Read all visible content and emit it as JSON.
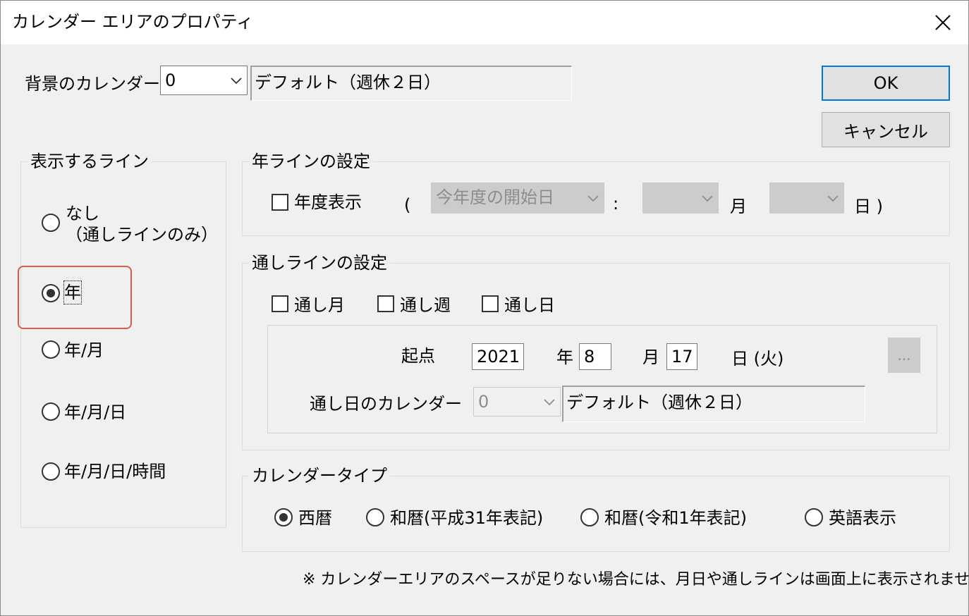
{
  "window": {
    "title": "カレンダー エリアのプロパティ"
  },
  "background_calendar": {
    "label": "背景のカレンダー",
    "combo_value": "0",
    "display_name": "デフォルト（週休２日）"
  },
  "buttons": {
    "ok": "OK",
    "cancel": "キャンセル",
    "ellipsis": "..."
  },
  "display_lines": {
    "title": "表示するライン",
    "options": [
      {
        "label": "なし",
        "sub": "（通しラインのみ）",
        "selected": false
      },
      {
        "label": "年",
        "selected": true
      },
      {
        "label": "年/月",
        "selected": false
      },
      {
        "label": "年/月/日",
        "selected": false
      },
      {
        "label": "年/月/日/時間",
        "selected": false
      }
    ]
  },
  "year_line": {
    "title": "年ラインの設定",
    "fiscal_checkbox": "年度表示",
    "open_paren": "(",
    "start_combo": "今年度の開始日",
    "colon": ":",
    "month_label": "月",
    "day_label": "日 )"
  },
  "through_line": {
    "title": "通しラインの設定",
    "checkboxes": [
      "通し月",
      "通し週",
      "通し日"
    ],
    "start_label": "起点",
    "year_value": "2021",
    "year_unit": "年",
    "month_value": "8",
    "month_unit": "月",
    "day_value": "17",
    "day_unit": "日 (火)",
    "calendar_label": "通し日のカレンダー",
    "calendar_combo": "0",
    "calendar_name": "デフォルト（週休２日）"
  },
  "calendar_type": {
    "title": "カレンダータイプ",
    "options": [
      {
        "label": "西暦",
        "selected": true
      },
      {
        "label": "和暦(平成31年表記)",
        "selected": false
      },
      {
        "label": "和暦(令和1年表記)",
        "selected": false
      },
      {
        "label": "英語表示",
        "selected": false
      }
    ]
  },
  "note": "※ カレンダーエリアのスペースが足りない場合には、月日や通しラインは画面上に表示されません。"
}
